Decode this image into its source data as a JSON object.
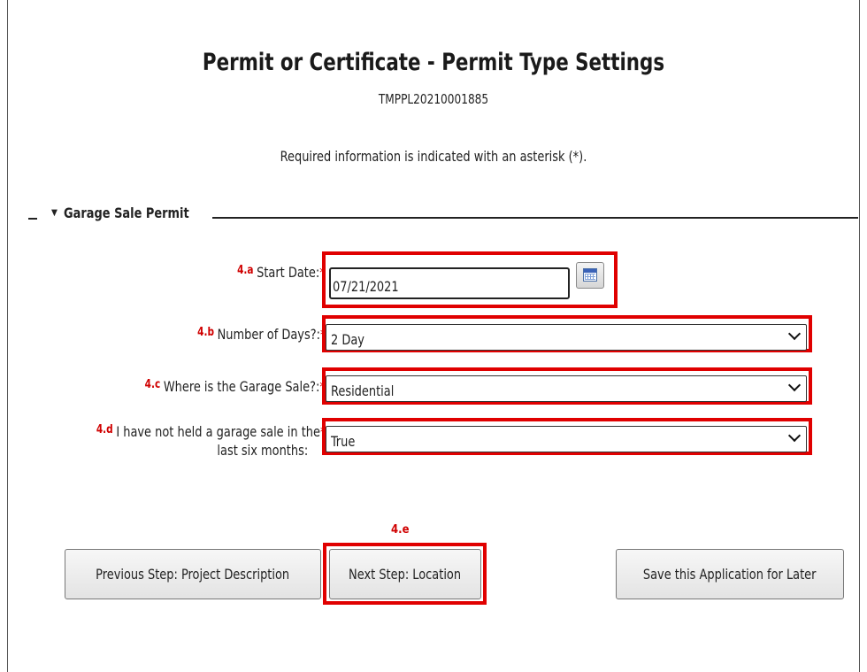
{
  "page": {
    "title": "Permit or Certificate - Permit Type Settings",
    "record_number": "TMPPL20210001885",
    "required_note": "Required information is indicated with an asterisk (*)."
  },
  "section": {
    "title": "Garage Sale Permit",
    "toggle_icon": "triangle-down-icon"
  },
  "fields": {
    "start_date": {
      "tag": "4.a",
      "label": "Start Date:",
      "required_mark": "*",
      "value": "07/21/2021",
      "icon": "calendar-icon"
    },
    "num_days": {
      "tag": "4.b",
      "label": "Number of Days?:",
      "required_mark": "*",
      "value": "2 Day"
    },
    "location": {
      "tag": "4.c",
      "label": "Where is the Garage Sale?:",
      "required_mark": "*",
      "value": "Residential"
    },
    "no_prior": {
      "tag": "4.d",
      "label_line1": "I have not held a garage sale in the",
      "label_line2": "last six months:",
      "required_mark": "*",
      "value": "True"
    }
  },
  "buttons": {
    "next_tag": "4.e",
    "previous": "Previous Step: Project Description",
    "next": "Next Step: Location",
    "save": "Save this Application for Later"
  },
  "colors": {
    "highlight": "#e00000",
    "required": "#d00000"
  }
}
